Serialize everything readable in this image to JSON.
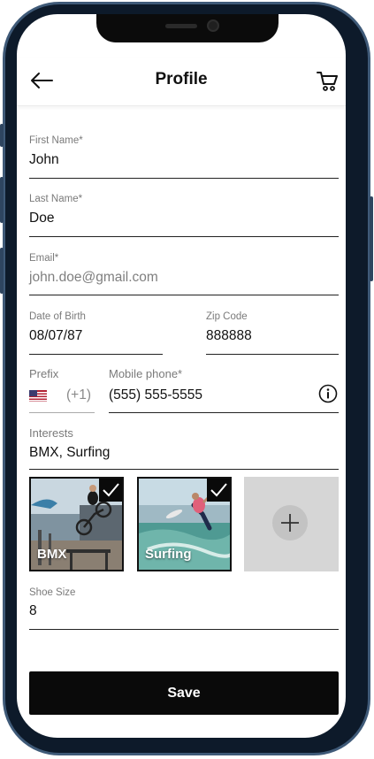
{
  "header": {
    "title": "Profile"
  },
  "form": {
    "first_name": {
      "label": "First Name*",
      "value": "John"
    },
    "last_name": {
      "label": "Last Name*",
      "value": "Doe"
    },
    "email": {
      "label": "Email*",
      "value": "john.doe@gmail.com"
    },
    "dob": {
      "label": "Date of Birth",
      "value": "08/07/87"
    },
    "zip": {
      "label": "Zip Code",
      "value": "888888"
    },
    "prefix": {
      "label": "Prefix",
      "value": "(+1)",
      "flag": "us-flag-icon"
    },
    "mobile": {
      "label": "Mobile phone*",
      "value": "(555) 555-5555"
    },
    "interests": {
      "label": "Interests",
      "value": "BMX, Surfing"
    },
    "shoe_size": {
      "label": "Shoe Size",
      "value": "8"
    }
  },
  "interest_tiles": [
    {
      "label": "BMX",
      "selected": true
    },
    {
      "label": "Surfing",
      "selected": true
    }
  ],
  "actions": {
    "save_label": "Save"
  },
  "icons": {
    "back": "back-arrow-icon",
    "cart": "cart-icon",
    "info": "info-icon",
    "add": "plus-icon",
    "check": "checkmark-icon"
  }
}
